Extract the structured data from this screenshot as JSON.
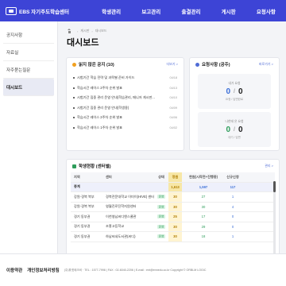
{
  "header": {
    "logo": "EBS 자기주도학습센터",
    "nav": [
      "학생관리",
      "보고관리",
      "출결관리",
      "게시판",
      "요청사항"
    ]
  },
  "sidebar": {
    "items": [
      "공지사항",
      "자료실",
      "자주묻는질문",
      "대시보드"
    ],
    "active_index": 3
  },
  "breadcrumb": [
    "게시판",
    "대시보드"
  ],
  "page_title": "대시보드",
  "notices": {
    "title": "읽지 않은 공지 (10)",
    "more": "더보기 >",
    "items": [
      {
        "title": "시험기간 학습 전략 및 과목별 준비 가이드",
        "date": "04/18"
      },
      {
        "title": "학습시간 레이스 2주차 순위 발표",
        "date": "04/13"
      },
      {
        "title": "시험기간 집중 관리 운영 안내(학습관리, 매니저 게시판...",
        "date": "04/10"
      },
      {
        "title": "시험기간 집중 관리 운영 안내(학생용)",
        "date": "04/09"
      },
      {
        "title": "학습시간 레이스 2주차 순위 발표",
        "date": "04/06"
      },
      {
        "title": "학습시간 레이스 1주차 순위 발표",
        "date": "04/02"
      }
    ]
  },
  "requests": {
    "title": "요청사항 (공주)",
    "more": "바로가기 >",
    "box1": {
      "label": "내가 요청",
      "a": "0",
      "b": "0",
      "sub": "요청 / 답변완료"
    },
    "box2": {
      "label": "나한테 온 요청",
      "a": "0",
      "b": "0",
      "sub": "대기 / 답변"
    }
  },
  "status": {
    "title": "학생현황 (센터별)",
    "more": "관리 >",
    "columns": [
      "지역",
      "센터",
      "상태",
      "정원",
      "현원(시작전+진행중)",
      "신규신청"
    ],
    "total": {
      "region": "종계",
      "center": "",
      "state": "",
      "quota": "1,613",
      "current": "1,597",
      "new": "117"
    },
    "rows": [
      {
        "region": "강원·경북 북부",
        "center": "경북전문대학교 이미이(HIVE) 센터",
        "state": "운영",
        "quota": "30",
        "current": "27",
        "new": "1"
      },
      {
        "region": "강원·경북 북부",
        "center": "영월진로진학지원센터",
        "state": "운영",
        "quota": "30",
        "current": "30",
        "new": "4"
      },
      {
        "region": "경기 동부권",
        "center": "이천영남씨디엔스쿨관",
        "state": "운영",
        "quota": "25",
        "current": "17",
        "new": "0"
      },
      {
        "region": "경기 동부권",
        "center": "조홍고등학교",
        "state": "운영",
        "quota": "30",
        "current": "29",
        "new": "0"
      },
      {
        "region": "경기 동부권",
        "center": "하남씨네도서관(씨디)",
        "state": "운영",
        "quota": "30",
        "current": "18",
        "new": "1"
      }
    ]
  },
  "footer": {
    "links": [
      "이용약관",
      "개인정보처리방침"
    ],
    "info": "(주)휴넷테크비 · TEL : 1577-7998 | FAX : 02-6040-2206 | E-mail : ent@ennedu.co.kr Copyright © ORBLM LOGIC"
  },
  "colors": {
    "brand": "#3d44d6",
    "accent_blue": "#3b6fd8",
    "accent_green": "#2e9d5b",
    "quota_yellow": "#fff4d1"
  }
}
